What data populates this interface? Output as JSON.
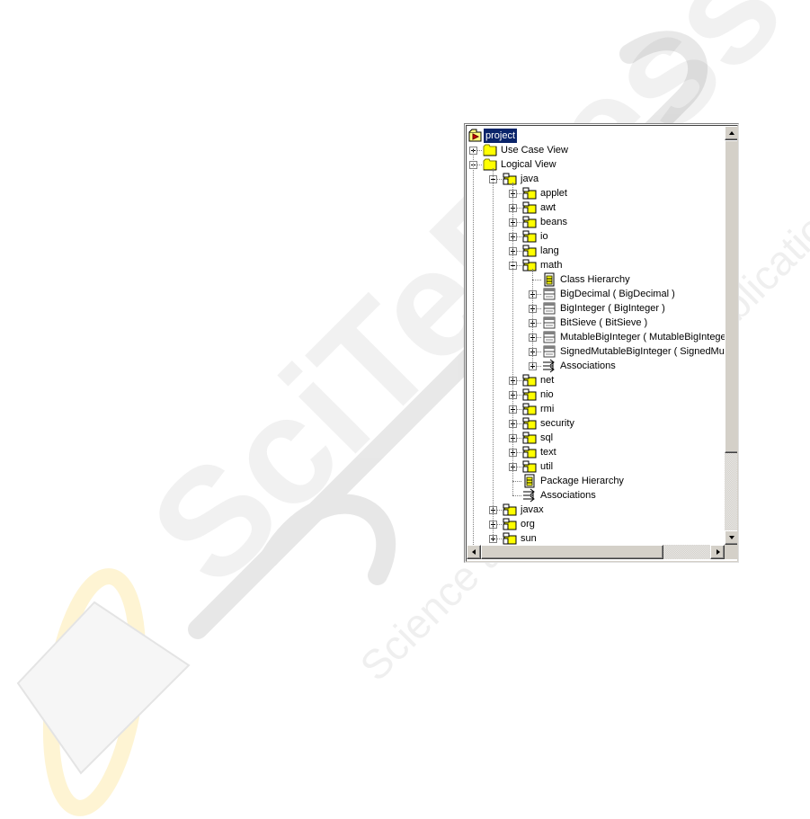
{
  "watermark": {
    "brand": "SciTePress",
    "tagline": "Science and Technology Publications"
  },
  "tree": {
    "nodes": [
      {
        "label": "project",
        "icon": "project-icon",
        "depth": 0,
        "expander": "none",
        "selected": true
      },
      {
        "label": "Use Case View",
        "icon": "folder-icon",
        "depth": 0,
        "expander": "plus"
      },
      {
        "label": "Logical View",
        "icon": "folder-icon",
        "depth": 0,
        "expander": "minus"
      },
      {
        "label": "java",
        "icon": "package-icon",
        "depth": 1,
        "expander": "minus"
      },
      {
        "label": "applet",
        "icon": "package-icon",
        "depth": 2,
        "expander": "plus"
      },
      {
        "label": "awt",
        "icon": "package-icon",
        "depth": 2,
        "expander": "plus"
      },
      {
        "label": "beans",
        "icon": "package-icon",
        "depth": 2,
        "expander": "plus"
      },
      {
        "label": "io",
        "icon": "package-icon",
        "depth": 2,
        "expander": "plus"
      },
      {
        "label": "lang",
        "icon": "package-icon",
        "depth": 2,
        "expander": "plus"
      },
      {
        "label": "math",
        "icon": "package-icon",
        "depth": 2,
        "expander": "minus"
      },
      {
        "label": "Class Hierarchy",
        "icon": "diagram-icon",
        "depth": 3,
        "expander": "none"
      },
      {
        "label": "BigDecimal ( BigDecimal )",
        "icon": "class-icon",
        "depth": 3,
        "expander": "plus"
      },
      {
        "label": "BigInteger ( BigInteger )",
        "icon": "class-icon",
        "depth": 3,
        "expander": "plus"
      },
      {
        "label": "BitSieve ( BitSieve )",
        "icon": "class-icon",
        "depth": 3,
        "expander": "plus"
      },
      {
        "label": "MutableBigInteger ( MutableBigInteger )",
        "icon": "class-icon",
        "depth": 3,
        "expander": "plus"
      },
      {
        "label": "SignedMutableBigInteger ( SignedMutableBigInteger )",
        "icon": "class-icon",
        "depth": 3,
        "expander": "plus"
      },
      {
        "label": "Associations",
        "icon": "associations-icon",
        "depth": 3,
        "expander": "plus"
      },
      {
        "label": "net",
        "icon": "package-icon",
        "depth": 2,
        "expander": "plus"
      },
      {
        "label": "nio",
        "icon": "package-icon",
        "depth": 2,
        "expander": "plus"
      },
      {
        "label": "rmi",
        "icon": "package-icon",
        "depth": 2,
        "expander": "plus"
      },
      {
        "label": "security",
        "icon": "package-icon",
        "depth": 2,
        "expander": "plus"
      },
      {
        "label": "sql",
        "icon": "package-icon",
        "depth": 2,
        "expander": "plus"
      },
      {
        "label": "text",
        "icon": "package-icon",
        "depth": 2,
        "expander": "plus"
      },
      {
        "label": "util",
        "icon": "package-icon",
        "depth": 2,
        "expander": "plus"
      },
      {
        "label": "Package Hierarchy",
        "icon": "diagram-icon",
        "depth": 2,
        "expander": "none"
      },
      {
        "label": "Associations",
        "icon": "associations-icon",
        "depth": 2,
        "expander": "none"
      },
      {
        "label": "javax",
        "icon": "package-icon",
        "depth": 1,
        "expander": "plus"
      },
      {
        "label": "org",
        "icon": "package-icon",
        "depth": 1,
        "expander": "plus"
      },
      {
        "label": "sun",
        "icon": "package-icon",
        "depth": 1,
        "expander": "plus"
      }
    ]
  },
  "scrollbars": {
    "vertical": {
      "position_fraction": 0.0,
      "visible_fraction": 0.77
    },
    "horizontal": {
      "position_fraction": 0.0,
      "visible_fraction": 0.77
    }
  },
  "colors": {
    "selection": "#0a246a",
    "folder_fill": "#ffff00",
    "chrome": "#d4d0c8"
  }
}
